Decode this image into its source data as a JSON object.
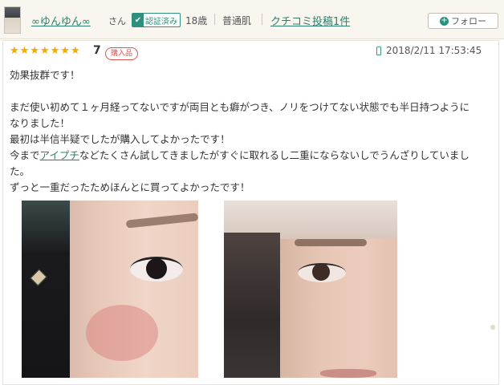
{
  "header": {
    "username": "∞ゆんゆん∞",
    "honorific": "さん",
    "verified_label": "認証済み",
    "verified_icon": "checkmark-icon",
    "age": "18歳",
    "skin_type": "普通肌",
    "posts_link": "クチコミ投稿1件",
    "follow_button": "フォロー",
    "follow_icon": "plus-icon"
  },
  "review": {
    "stars": 7,
    "star_max": 7,
    "star_color": "#f2a900",
    "rating_label": "7",
    "purchased_badge": "購入品",
    "device_icon": "mobile-phone-icon",
    "date": "2018/2/11 17:53:45",
    "title_line": "効果抜群です！",
    "lines": [
      "まだ使い初めて１ヶ月経ってないですが両目とも癖がつき、ノリをつけてない状態でも半日持つように",
      "なりました！",
      "最初は半信半疑でしたが購入してよかったです！"
    ],
    "line4_before": "今まで",
    "line4_link": "アイプチ",
    "line4_after": "などたくさん試してきましたがすぐに取れるし二重にならないしでうんざりしていまし",
    "line5": "た。",
    "line6": "ずっと一重だったためほんとに買ってよかったです！"
  },
  "colors": {
    "accent": "#2d7f6d",
    "badge_red": "#d9534f"
  }
}
